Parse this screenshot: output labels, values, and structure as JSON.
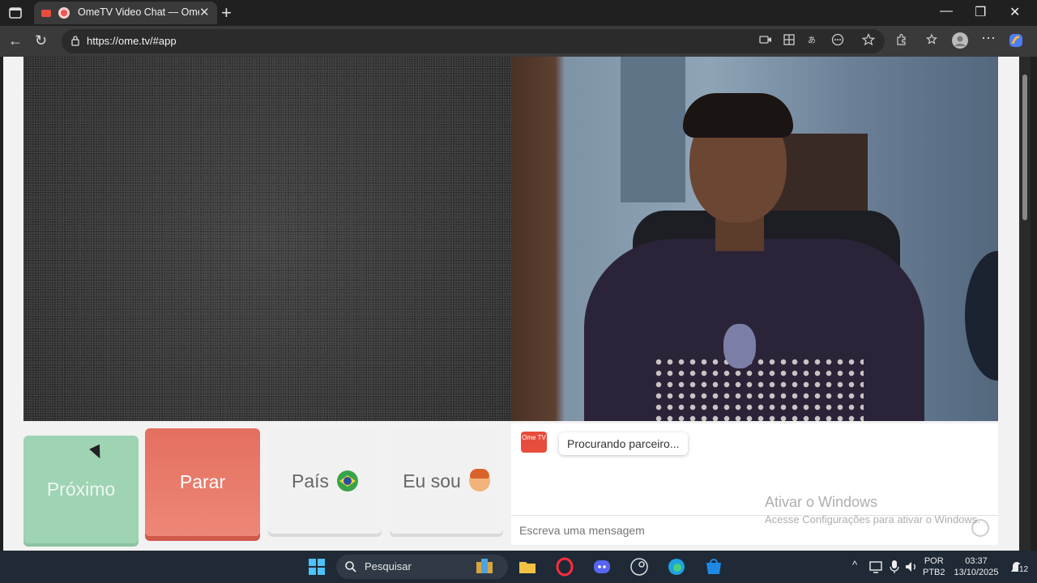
{
  "browser": {
    "tab_title": "OmeTV Video Chat — Omeg",
    "url": "https://ome.tv/#app"
  },
  "app": {
    "buttons": {
      "next": "Próximo",
      "stop": "Parar",
      "country": "País",
      "i_am": "Eu sou"
    },
    "chat": {
      "logo_text": "Ome TV",
      "status_message": "Procurando parceiro...",
      "input_placeholder": "Escreva uma mensagem"
    }
  },
  "watermark": {
    "line1": "Ativar o Windows",
    "line2": "Acesse Configurações para ativar o Windows."
  },
  "taskbar": {
    "search_label": "Pesquisar",
    "lang_line1": "POR",
    "lang_line2": "PTB2",
    "time": "03:37",
    "date": "13/10/2025",
    "notification_count": "12"
  },
  "colors": {
    "next_button": "#9ed3b3",
    "stop_button": "#e46f5f",
    "brand_red": "#e74c3c"
  }
}
